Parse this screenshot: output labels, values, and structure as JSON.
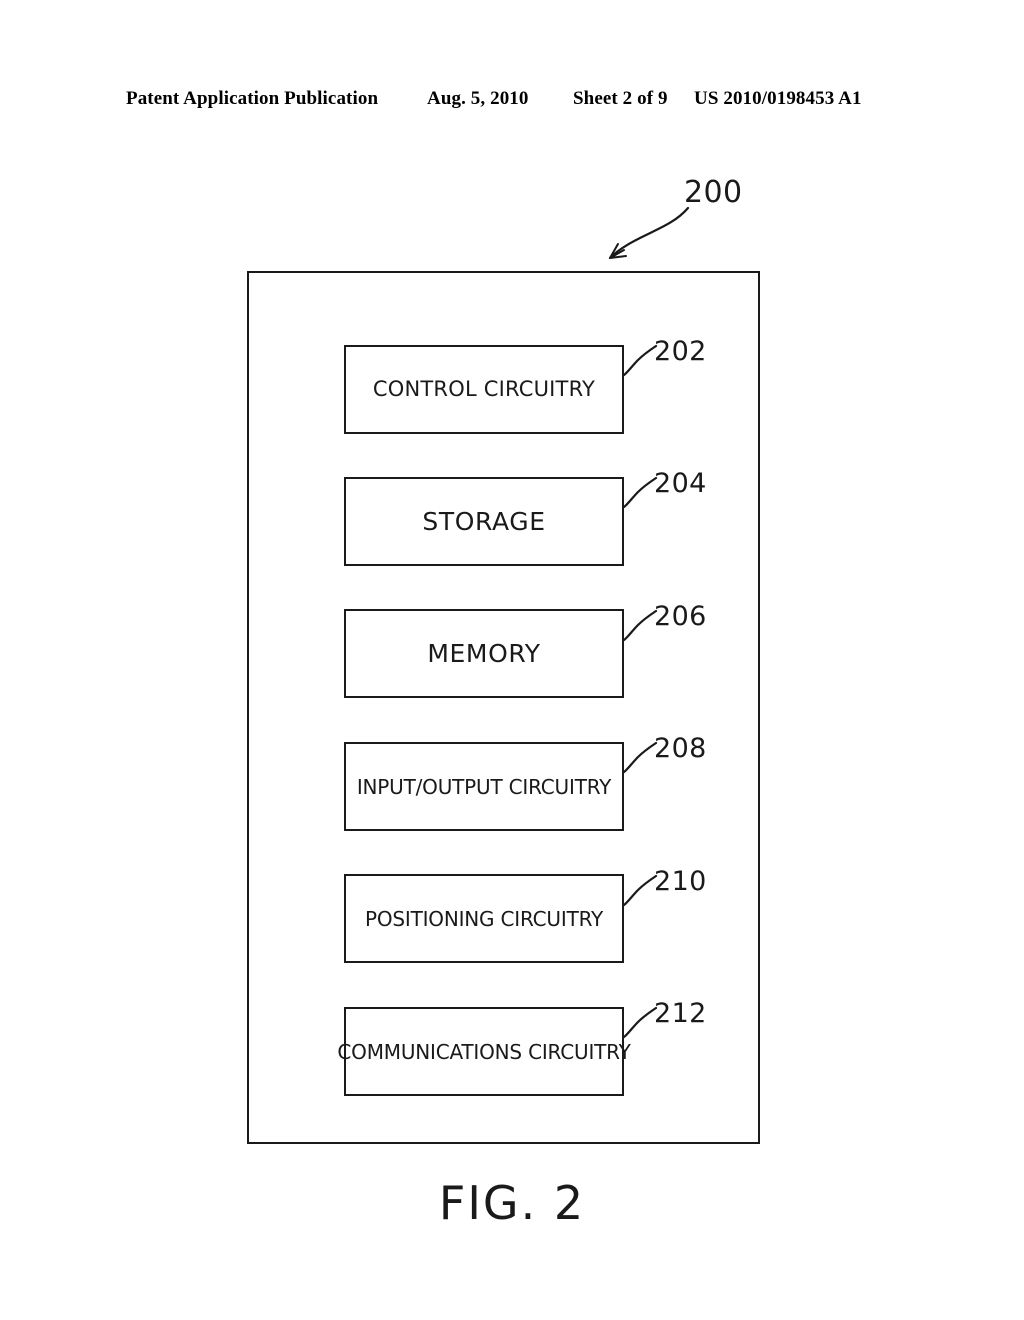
{
  "header": {
    "title": "Patent Application Publication",
    "date": "Aug. 5, 2010",
    "sheet": "Sheet 2 of 9",
    "publication_number": "US 2010/0198453 A1"
  },
  "figure": {
    "caption": "FIG. 2",
    "device_reference": "200",
    "blocks": [
      {
        "label": "CONTROL CIRCUITRY",
        "ref": "202",
        "size": "md"
      },
      {
        "label": "STORAGE",
        "ref": "204",
        "size": "lg"
      },
      {
        "label": "MEMORY",
        "ref": "206",
        "size": "lg"
      },
      {
        "label": "INPUT/OUTPUT CIRCUITRY",
        "ref": "208",
        "size": "sm"
      },
      {
        "label": "POSITIONING CIRCUITRY",
        "ref": "210",
        "size": "sm"
      },
      {
        "label": "COMMUNICATIONS CIRCUITRY",
        "ref": "212",
        "size": "sm"
      }
    ]
  },
  "style": {
    "ink": "#1a1a1a",
    "paper": "#ffffff"
  }
}
